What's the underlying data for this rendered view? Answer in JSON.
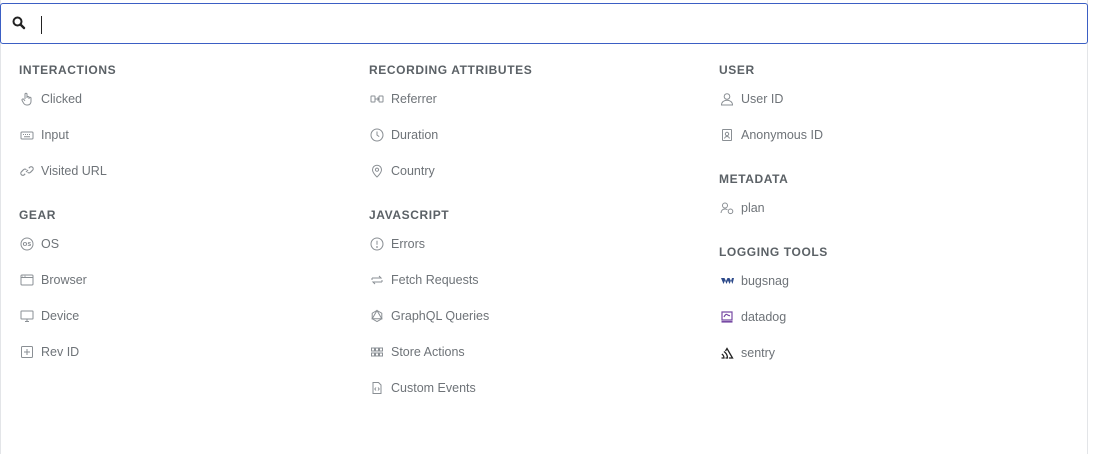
{
  "search": {
    "value": "",
    "placeholder": ""
  },
  "columns": [
    {
      "groups": [
        {
          "heading": "INTERACTIONS",
          "items": [
            {
              "label": "Clicked",
              "icon": "pointer-hand-icon"
            },
            {
              "label": "Input",
              "icon": "keyboard-icon"
            },
            {
              "label": "Visited URL",
              "icon": "link-icon"
            }
          ]
        },
        {
          "heading": "GEAR",
          "items": [
            {
              "label": "OS",
              "icon": "os-icon"
            },
            {
              "label": "Browser",
              "icon": "browser-window-icon"
            },
            {
              "label": "Device",
              "icon": "monitor-icon"
            },
            {
              "label": "Rev ID",
              "icon": "rev-id-icon"
            }
          ]
        }
      ]
    },
    {
      "groups": [
        {
          "heading": "RECORDING ATTRIBUTES",
          "items": [
            {
              "label": "Referrer",
              "icon": "referrer-icon"
            },
            {
              "label": "Duration",
              "icon": "clock-icon"
            },
            {
              "label": "Country",
              "icon": "map-pin-icon"
            }
          ]
        },
        {
          "heading": "JAVASCRIPT",
          "items": [
            {
              "label": "Errors",
              "icon": "error-circle-icon"
            },
            {
              "label": "Fetch Requests",
              "icon": "fetch-arrows-icon"
            },
            {
              "label": "GraphQL Queries",
              "icon": "graphql-icon"
            },
            {
              "label": "Store Actions",
              "icon": "store-actions-icon"
            },
            {
              "label": "Custom Events",
              "icon": "code-file-icon"
            }
          ]
        }
      ]
    },
    {
      "groups": [
        {
          "heading": "USER",
          "items": [
            {
              "label": "User ID",
              "icon": "user-icon"
            },
            {
              "label": "Anonymous ID",
              "icon": "id-badge-icon"
            }
          ]
        },
        {
          "heading": "METADATA",
          "items": [
            {
              "label": "plan",
              "icon": "user-tag-icon"
            }
          ]
        },
        {
          "heading": "LOGGING TOOLS",
          "items": [
            {
              "label": "bugsnag",
              "icon": "bugsnag-logo-icon"
            },
            {
              "label": "datadog",
              "icon": "datadog-logo-icon"
            },
            {
              "label": "sentry",
              "icon": "sentry-logo-icon"
            }
          ]
        }
      ]
    }
  ],
  "colors": {
    "focus_border": "#3b5fc4",
    "heading": "#5b6166",
    "item": "#6e7378",
    "bugsnag": "#2d4a8a",
    "datadog": "#774aa4"
  }
}
